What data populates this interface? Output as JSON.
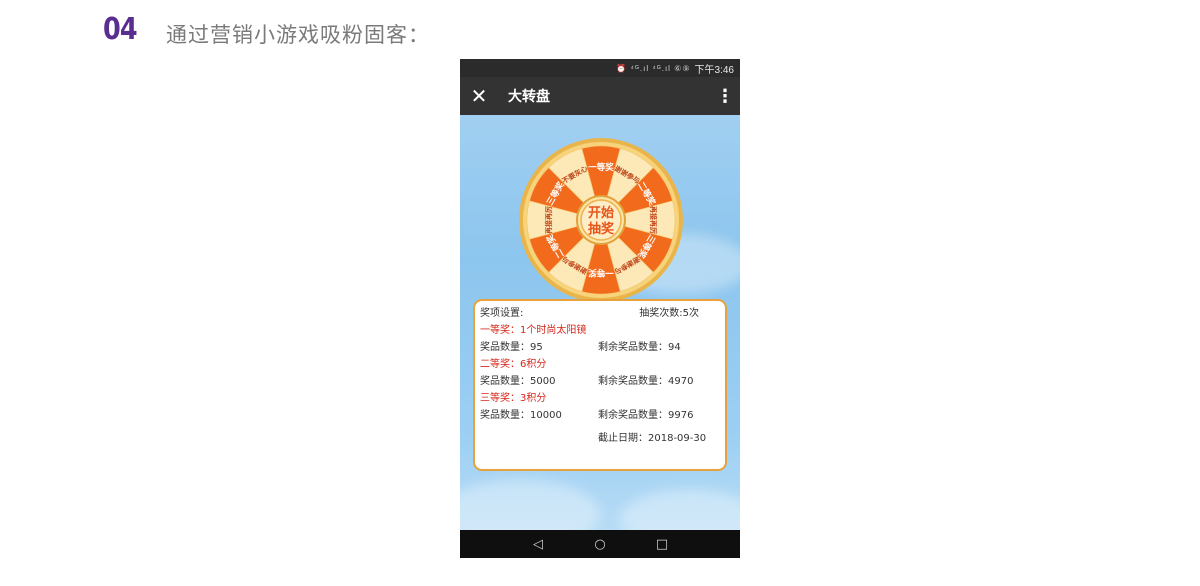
{
  "slide": {
    "number": "04",
    "title": "通过营销小游戏吸粉固客："
  },
  "status_bar": {
    "icons": "⏰ ⁴ᴳ.ıl ⁴ᴳ.ıl ⑥⑨",
    "time": "下午3:46"
  },
  "nav": {
    "close_icon": "✕",
    "title": "大转盘",
    "more_icon": "⋮"
  },
  "wheel": {
    "center_line1": "开始",
    "center_line2": "抽奖",
    "segments": [
      "一等奖",
      "谢谢参与",
      "二等奖",
      "再接再厉",
      "三等奖",
      "谢谢参与",
      "一等奖",
      "谢谢参与",
      "二等奖",
      "再接再厉",
      "三等奖",
      "不要灰心"
    ],
    "colors": {
      "orange": "#f26b1d",
      "cream": "#fde9b8",
      "gold_rim": "#e9b54a"
    }
  },
  "prizes": {
    "settings_label": "奖项设置:",
    "draw_count": "抽奖次数:5次",
    "items": [
      {
        "name": "一等奖：1个时尚太阳镜",
        "qty": "奖品数量：95",
        "remaining": "剩余奖品数量：94"
      },
      {
        "name": "二等奖：6积分",
        "qty": "奖品数量：5000",
        "remaining": "剩余奖品数量：4970"
      },
      {
        "name": "三等奖：3积分",
        "qty": "奖品数量：10000",
        "remaining": "剩余奖品数量：9976"
      }
    ],
    "deadline": "截止日期：2018-09-30"
  },
  "android_nav": {
    "back_icon": "◁",
    "home_icon": "○",
    "recent_icon": "□"
  }
}
